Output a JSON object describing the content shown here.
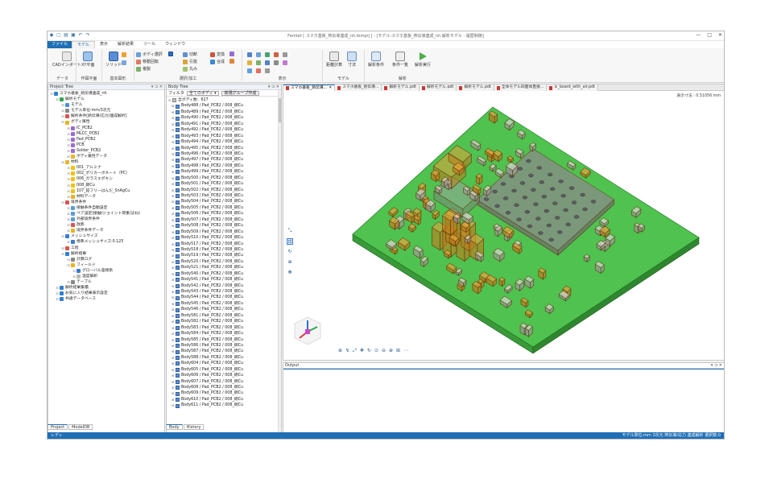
{
  "window": {
    "title": "Femtet [ スマホ基板_熱伝導連成_nh.femprj ] - [モデル:スマホ基板_熱伝導連成_nh.解析モデル - 履歴制御]",
    "controls": [
      "—",
      "□",
      "✕"
    ]
  },
  "menu": {
    "file": "ファイル",
    "items": [
      "モデル",
      "表示",
      "解析結果",
      "ツール",
      "ウィンドウ"
    ],
    "active": "モデル"
  },
  "ribbon": {
    "groups": [
      {
        "label": "データ",
        "buttons": [
          "CADインポート"
        ]
      },
      {
        "label": "作図平面",
        "buttons": [
          "XY平面"
        ]
      },
      {
        "label": "基本図形",
        "buttons": [
          "ソリッド"
        ]
      },
      {
        "label": "選択/加工",
        "rows": [
          "ボディ選択",
          "移動回転",
          "複製",
          "切断",
          "引抜",
          "丸み",
          "変換",
          "合成"
        ]
      },
      {
        "label": "表示",
        "rows": []
      },
      {
        "label": "モデル",
        "buttons": [
          "距離計算",
          "寸法"
        ]
      },
      {
        "label": "解析",
        "buttons": [
          "解析条件",
          "条件一覧",
          "解析実行"
        ]
      }
    ]
  },
  "project_tree": {
    "header": "Project Tree",
    "items": [
      {
        "level": 0,
        "label": "スマホ基板_熱伝導連成_nh",
        "icon": "project-icon",
        "color": "#2f7fd1"
      },
      {
        "level": 1,
        "label": "解析モデル",
        "icon": "model-icon",
        "color": "#2fa84f"
      },
      {
        "level": 2,
        "label": "モデル",
        "icon": "shape-icon",
        "color": "#4a90d9"
      },
      {
        "level": 2,
        "label": "モデル単位:mm/3次元",
        "icon": "unit-icon",
        "color": "#888888"
      },
      {
        "level": 2,
        "label": "解析条件[熱伝導/応力/連成解析]",
        "icon": "condition-icon",
        "color": "#d9534f"
      },
      {
        "level": 2,
        "label": "ボディ属性",
        "icon": "folder-icon",
        "color": "#e6b422"
      },
      {
        "level": 3,
        "label": "IC_PCB2",
        "icon": "attr-icon",
        "color": "#9c6bd1"
      },
      {
        "level": 3,
        "label": "MLCC_PCB2",
        "icon": "attr-icon",
        "color": "#9c6bd1"
      },
      {
        "level": 3,
        "label": "Pad_PCB2",
        "icon": "attr-icon",
        "color": "#9c6bd1"
      },
      {
        "level": 3,
        "label": "PCB",
        "icon": "attr-icon",
        "color": "#9c6bd1"
      },
      {
        "level": 3,
        "label": "Solder_PCB2",
        "icon": "attr-icon",
        "color": "#9c6bd1"
      },
      {
        "level": 3,
        "label": "ボディ属性データ",
        "icon": "data-icon",
        "color": "#e6b422"
      },
      {
        "level": 2,
        "label": "材料",
        "icon": "folder-icon",
        "color": "#e6b422"
      },
      {
        "level": 3,
        "label": "001_アルミナ",
        "icon": "warning-icon",
        "color": "#f2c200"
      },
      {
        "level": 3,
        "label": "002_ポリカーボネート（PC）",
        "icon": "warning-icon",
        "color": "#f2c200"
      },
      {
        "level": 3,
        "label": "006_ガラスエポキシ",
        "icon": "warning-icon",
        "color": "#f2c200"
      },
      {
        "level": 3,
        "label": "008_銅Cu",
        "icon": "warning-icon",
        "color": "#f2c200"
      },
      {
        "level": 3,
        "label": "107_鉛フリーはんだ_SnAgCu",
        "icon": "warning-icon",
        "color": "#f2c200"
      },
      {
        "level": 3,
        "label": "材料データ",
        "icon": "data-icon",
        "color": "#e6b422"
      },
      {
        "level": 2,
        "label": "境界条件",
        "icon": "boundary-icon",
        "color": "#d9534f"
      },
      {
        "level": 3,
        "label": "接触条件自動設定",
        "icon": "contact-icon",
        "color": "#5b9bd5"
      },
      {
        "level": 3,
        "label": "ペア設定(接触/ジョイント荷重/ばね)",
        "icon": "pair-icon",
        "color": "#5b9bd5"
      },
      {
        "level": 3,
        "label": "外部境界条件",
        "icon": "outer-icon",
        "color": "#5b9bd5"
      },
      {
        "level": 3,
        "label": "放熱",
        "icon": "heat-icon",
        "color": "#d9534f"
      },
      {
        "level": 3,
        "label": "境界条件データ",
        "icon": "data-icon",
        "color": "#e6b422"
      },
      {
        "level": 2,
        "label": "メッシュサイズ",
        "icon": "mesh-icon",
        "color": "#3a7bd5"
      },
      {
        "level": 3,
        "label": "標準メッシュサイズ:0.125",
        "icon": "mesh-size-icon",
        "color": "#3a7bd5"
      },
      {
        "level": 2,
        "label": "工程",
        "icon": "process-icon",
        "color": "#d9534f"
      },
      {
        "level": 2,
        "label": "解析結果",
        "icon": "result-icon",
        "color": "#2f7fd1"
      },
      {
        "level": 3,
        "label": "計算ログ",
        "icon": "log-icon",
        "color": "#888888"
      },
      {
        "level": 3,
        "label": "フィールド",
        "icon": "field-icon",
        "color": "#e6b422"
      },
      {
        "level": 4,
        "label": "グローバル座標系",
        "icon": "coord-icon",
        "color": "#3a7bd5"
      },
      {
        "level": 4,
        "label": "温度解析",
        "icon": "temp-icon",
        "color": "#bbbbbb"
      },
      {
        "level": 3,
        "label": "テーブル",
        "icon": "table-icon",
        "color": "#888888"
      },
      {
        "level": 1,
        "label": "解析結果集積",
        "icon": "collect-icon",
        "color": "#2f7fd1"
      },
      {
        "level": 1,
        "label": "お気に入り結果表示設定",
        "icon": "fav-icon",
        "color": "#2f7fd1"
      },
      {
        "level": 1,
        "label": "共通データベース",
        "icon": "db-icon",
        "color": "#2f7fd1"
      }
    ],
    "bottom_tabs": [
      "Project",
      "ModelDB"
    ]
  },
  "body_tree": {
    "header": "Body Tree",
    "filter_label": "フィルタ",
    "filter_value": "全てのボディ",
    "group_button": "新規グループ作成",
    "total": "全ボディ数：627",
    "bodies": [
      "Body488 / Pad_PCB2 / 008_銅Cu",
      "Body489 / Pad_PCB2 / 008_銅Cu",
      "Body490 / Pad_PCB2 / 008_銅Cu",
      "Body491 / Pad_PCB2 / 008_銅Cu",
      "Body492 / Pad_PCB2 / 008_銅Cu",
      "Body493 / Pad_PCB2 / 008_銅Cu",
      "Body494 / Pad_PCB2 / 008_銅Cu",
      "Body495 / Pad_PCB2 / 008_銅Cu",
      "Body496 / Pad_PCB2 / 008_銅Cu",
      "Body497 / Pad_PCB2 / 008_銅Cu",
      "Body498 / Pad_PCB2 / 008_銅Cu",
      "Body499 / Pad_PCB2 / 008_銅Cu",
      "Body500 / Pad_PCB2 / 008_銅Cu",
      "Body501 / Pad_PCB2 / 008_銅Cu",
      "Body502 / Pad_PCB2 / 008_銅Cu",
      "Body503 / Pad_PCB2 / 008_銅Cu",
      "Body504 / Pad_PCB2 / 008_銅Cu",
      "Body505 / Pad_PCB2 / 008_銅Cu",
      "Body506 / Pad_PCB2 / 008_銅Cu",
      "Body507 / Pad_PCB2 / 008_銅Cu",
      "Body508 / Pad_PCB2 / 008_銅Cu",
      "Body509 / Pad_PCB2 / 008_銅Cu",
      "Body510 / Pad_PCB2 / 008_銅Cu",
      "Body517 / Pad_PCB2 / 008_銅Cu",
      "Body518 / Pad_PCB2 / 008_銅Cu",
      "Body519 / Pad_PCB2 / 008_銅Cu",
      "Body520 / Pad_PCB2 / 008_銅Cu",
      "Body521 / Pad_PCB2 / 008_銅Cu",
      "Body540 / Pad_PCB2 / 008_銅Cu",
      "Body541 / Pad_PCB2 / 008_銅Cu",
      "Body542 / Pad_PCB2 / 008_銅Cu",
      "Body543 / Pad_PCB2 / 008_銅Cu",
      "Body544 / Pad_PCB2 / 008_銅Cu",
      "Body545 / Pad_PCB2 / 008_銅Cu",
      "Body546 / Pad_PCB2 / 008_銅Cu",
      "Body581 / Pad_PCB2 / 008_銅Cu",
      "Body582 / Pad_PCB2 / 008_銅Cu",
      "Body583 / Pad_PCB2 / 008_銅Cu",
      "Body584 / Pad_PCB2 / 008_銅Cu",
      "Body585 / Pad_PCB2 / 008_銅Cu",
      "Body586 / Pad_PCB2 / 008_銅Cu",
      "Body587 / Pad_PCB2 / 008_銅Cu",
      "Body588 / Pad_PCB2 / 008_銅Cu",
      "Body604 / Pad_PCB2 / 008_銅Cu",
      "Body605 / Pad_PCB2 / 008_銅Cu",
      "Body606 / Pad_PCB2 / 008_銅Cu",
      "Body607 / Pad_PCB2 / 008_銅Cu",
      "Body608 / Pad_PCB2 / 008_銅Cu",
      "Body609 / Pad_PCB2 / 008_銅Cu",
      "Body610 / Pad_PCB2 / 008_銅Cu",
      "Body611 / Pad_PCB2 / 008_銅Cu"
    ],
    "bottom_tabs": [
      "Body",
      "History"
    ]
  },
  "doc_tabs": [
    {
      "label": "スマホ基板_熱伝導...",
      "selected": true
    },
    {
      "label": "スマホ基板_熱伝導...",
      "selected": false
    },
    {
      "label": "解析モデル.pdt",
      "selected": false
    },
    {
      "label": "解析モデル.pdt",
      "selected": false
    },
    {
      "label": "解析モデル.pdt",
      "selected": false
    },
    {
      "label": "全体モデル四面体直接...",
      "selected": false
    },
    {
      "label": "ic_board_with_air.pdt",
      "selected": false
    }
  ],
  "viewport": {
    "scale": "表示寸法 : 0.51056 mm",
    "colors": {
      "pcb": "#4fc24f",
      "component": "#e8a23a",
      "ic": "#8a8a8a",
      "mlcc": "#d9d9d9"
    }
  },
  "output": {
    "header": "Output"
  },
  "status": {
    "left": "レディ",
    "right": "モデル単位:mm 3次元 熱伝導/応力 連成解析 選択数:0"
  }
}
